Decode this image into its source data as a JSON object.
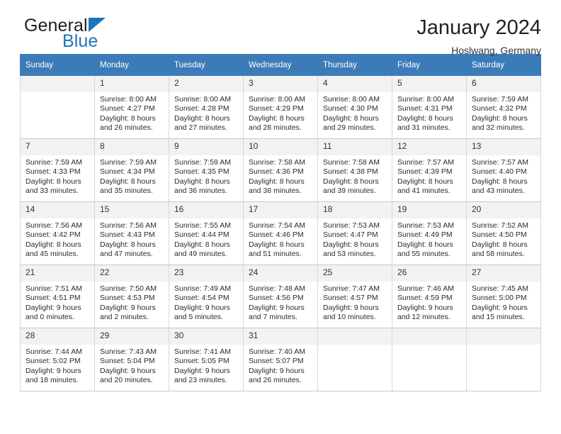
{
  "brand": {
    "name_top": "General",
    "name_bottom": "Blue",
    "accent_color": "#1b75bb"
  },
  "header": {
    "title": "January 2024",
    "subtitle": "Hoslwang, Germany"
  },
  "calendar": {
    "header_bg": "#3b7cb8",
    "weekdays": [
      "Sunday",
      "Monday",
      "Tuesday",
      "Wednesday",
      "Thursday",
      "Friday",
      "Saturday"
    ],
    "weeks": [
      [
        {
          "day": "",
          "sunrise": "",
          "sunset": "",
          "daylight_line1": "",
          "daylight_line2": ""
        },
        {
          "day": "1",
          "sunrise": "Sunrise: 8:00 AM",
          "sunset": "Sunset: 4:27 PM",
          "daylight_line1": "Daylight: 8 hours",
          "daylight_line2": "and 26 minutes."
        },
        {
          "day": "2",
          "sunrise": "Sunrise: 8:00 AM",
          "sunset": "Sunset: 4:28 PM",
          "daylight_line1": "Daylight: 8 hours",
          "daylight_line2": "and 27 minutes."
        },
        {
          "day": "3",
          "sunrise": "Sunrise: 8:00 AM",
          "sunset": "Sunset: 4:29 PM",
          "daylight_line1": "Daylight: 8 hours",
          "daylight_line2": "and 28 minutes."
        },
        {
          "day": "4",
          "sunrise": "Sunrise: 8:00 AM",
          "sunset": "Sunset: 4:30 PM",
          "daylight_line1": "Daylight: 8 hours",
          "daylight_line2": "and 29 minutes."
        },
        {
          "day": "5",
          "sunrise": "Sunrise: 8:00 AM",
          "sunset": "Sunset: 4:31 PM",
          "daylight_line1": "Daylight: 8 hours",
          "daylight_line2": "and 31 minutes."
        },
        {
          "day": "6",
          "sunrise": "Sunrise: 7:59 AM",
          "sunset": "Sunset: 4:32 PM",
          "daylight_line1": "Daylight: 8 hours",
          "daylight_line2": "and 32 minutes."
        }
      ],
      [
        {
          "day": "7",
          "sunrise": "Sunrise: 7:59 AM",
          "sunset": "Sunset: 4:33 PM",
          "daylight_line1": "Daylight: 8 hours",
          "daylight_line2": "and 33 minutes."
        },
        {
          "day": "8",
          "sunrise": "Sunrise: 7:59 AM",
          "sunset": "Sunset: 4:34 PM",
          "daylight_line1": "Daylight: 8 hours",
          "daylight_line2": "and 35 minutes."
        },
        {
          "day": "9",
          "sunrise": "Sunrise: 7:59 AM",
          "sunset": "Sunset: 4:35 PM",
          "daylight_line1": "Daylight: 8 hours",
          "daylight_line2": "and 36 minutes."
        },
        {
          "day": "10",
          "sunrise": "Sunrise: 7:58 AM",
          "sunset": "Sunset: 4:36 PM",
          "daylight_line1": "Daylight: 8 hours",
          "daylight_line2": "and 38 minutes."
        },
        {
          "day": "11",
          "sunrise": "Sunrise: 7:58 AM",
          "sunset": "Sunset: 4:38 PM",
          "daylight_line1": "Daylight: 8 hours",
          "daylight_line2": "and 39 minutes."
        },
        {
          "day": "12",
          "sunrise": "Sunrise: 7:57 AM",
          "sunset": "Sunset: 4:39 PM",
          "daylight_line1": "Daylight: 8 hours",
          "daylight_line2": "and 41 minutes."
        },
        {
          "day": "13",
          "sunrise": "Sunrise: 7:57 AM",
          "sunset": "Sunset: 4:40 PM",
          "daylight_line1": "Daylight: 8 hours",
          "daylight_line2": "and 43 minutes."
        }
      ],
      [
        {
          "day": "14",
          "sunrise": "Sunrise: 7:56 AM",
          "sunset": "Sunset: 4:42 PM",
          "daylight_line1": "Daylight: 8 hours",
          "daylight_line2": "and 45 minutes."
        },
        {
          "day": "15",
          "sunrise": "Sunrise: 7:56 AM",
          "sunset": "Sunset: 4:43 PM",
          "daylight_line1": "Daylight: 8 hours",
          "daylight_line2": "and 47 minutes."
        },
        {
          "day": "16",
          "sunrise": "Sunrise: 7:55 AM",
          "sunset": "Sunset: 4:44 PM",
          "daylight_line1": "Daylight: 8 hours",
          "daylight_line2": "and 49 minutes."
        },
        {
          "day": "17",
          "sunrise": "Sunrise: 7:54 AM",
          "sunset": "Sunset: 4:46 PM",
          "daylight_line1": "Daylight: 8 hours",
          "daylight_line2": "and 51 minutes."
        },
        {
          "day": "18",
          "sunrise": "Sunrise: 7:53 AM",
          "sunset": "Sunset: 4:47 PM",
          "daylight_line1": "Daylight: 8 hours",
          "daylight_line2": "and 53 minutes."
        },
        {
          "day": "19",
          "sunrise": "Sunrise: 7:53 AM",
          "sunset": "Sunset: 4:49 PM",
          "daylight_line1": "Daylight: 8 hours",
          "daylight_line2": "and 55 minutes."
        },
        {
          "day": "20",
          "sunrise": "Sunrise: 7:52 AM",
          "sunset": "Sunset: 4:50 PM",
          "daylight_line1": "Daylight: 8 hours",
          "daylight_line2": "and 58 minutes."
        }
      ],
      [
        {
          "day": "21",
          "sunrise": "Sunrise: 7:51 AM",
          "sunset": "Sunset: 4:51 PM",
          "daylight_line1": "Daylight: 9 hours",
          "daylight_line2": "and 0 minutes."
        },
        {
          "day": "22",
          "sunrise": "Sunrise: 7:50 AM",
          "sunset": "Sunset: 4:53 PM",
          "daylight_line1": "Daylight: 9 hours",
          "daylight_line2": "and 2 minutes."
        },
        {
          "day": "23",
          "sunrise": "Sunrise: 7:49 AM",
          "sunset": "Sunset: 4:54 PM",
          "daylight_line1": "Daylight: 9 hours",
          "daylight_line2": "and 5 minutes."
        },
        {
          "day": "24",
          "sunrise": "Sunrise: 7:48 AM",
          "sunset": "Sunset: 4:56 PM",
          "daylight_line1": "Daylight: 9 hours",
          "daylight_line2": "and 7 minutes."
        },
        {
          "day": "25",
          "sunrise": "Sunrise: 7:47 AM",
          "sunset": "Sunset: 4:57 PM",
          "daylight_line1": "Daylight: 9 hours",
          "daylight_line2": "and 10 minutes."
        },
        {
          "day": "26",
          "sunrise": "Sunrise: 7:46 AM",
          "sunset": "Sunset: 4:59 PM",
          "daylight_line1": "Daylight: 9 hours",
          "daylight_line2": "and 12 minutes."
        },
        {
          "day": "27",
          "sunrise": "Sunrise: 7:45 AM",
          "sunset": "Sunset: 5:00 PM",
          "daylight_line1": "Daylight: 9 hours",
          "daylight_line2": "and 15 minutes."
        }
      ],
      [
        {
          "day": "28",
          "sunrise": "Sunrise: 7:44 AM",
          "sunset": "Sunset: 5:02 PM",
          "daylight_line1": "Daylight: 9 hours",
          "daylight_line2": "and 18 minutes."
        },
        {
          "day": "29",
          "sunrise": "Sunrise: 7:43 AM",
          "sunset": "Sunset: 5:04 PM",
          "daylight_line1": "Daylight: 9 hours",
          "daylight_line2": "and 20 minutes."
        },
        {
          "day": "30",
          "sunrise": "Sunrise: 7:41 AM",
          "sunset": "Sunset: 5:05 PM",
          "daylight_line1": "Daylight: 9 hours",
          "daylight_line2": "and 23 minutes."
        },
        {
          "day": "31",
          "sunrise": "Sunrise: 7:40 AM",
          "sunset": "Sunset: 5:07 PM",
          "daylight_line1": "Daylight: 9 hours",
          "daylight_line2": "and 26 minutes."
        },
        {
          "day": "",
          "sunrise": "",
          "sunset": "",
          "daylight_line1": "",
          "daylight_line2": ""
        },
        {
          "day": "",
          "sunrise": "",
          "sunset": "",
          "daylight_line1": "",
          "daylight_line2": ""
        },
        {
          "day": "",
          "sunrise": "",
          "sunset": "",
          "daylight_line1": "",
          "daylight_line2": ""
        }
      ]
    ]
  }
}
